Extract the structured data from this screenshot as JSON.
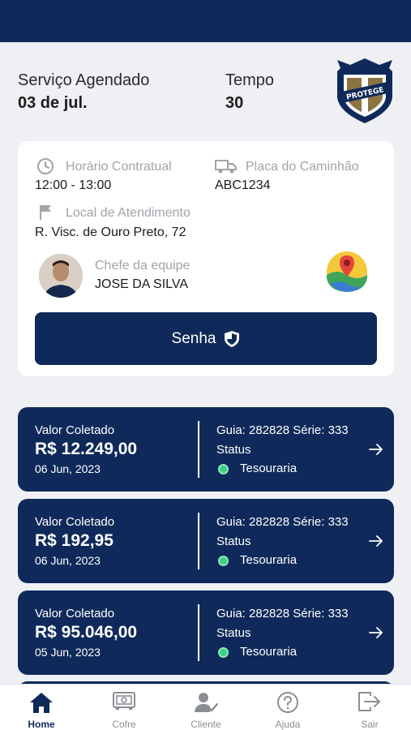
{
  "summary": {
    "service_label": "Serviço Agendado",
    "service_value": "03 de jul.",
    "time_label": "Tempo",
    "time_value": "30",
    "logo_text": "PROTEGE"
  },
  "details": {
    "contract_time_label": "Horário Contratual",
    "contract_time_value": "12:00 - 13:00",
    "truck_plate_label": "Placa do Caminhão",
    "truck_plate_value": "ABC1234",
    "location_label": "Local de Atendimento",
    "location_value": "R. Visc. de Ouro Preto, 72",
    "team_lead_label": "Chefe da equipe",
    "team_lead_value": "JOSE DA SILVA",
    "password_button": "Senha"
  },
  "transactions": [
    {
      "label": "Valor Coletado",
      "amount": "R$ 12.249,00",
      "date": "06 Jun, 2023",
      "guia": "Guia: 282828 Série: 333",
      "status_label": "Status",
      "status_value": "Tesouraria"
    },
    {
      "label": "Valor Coletado",
      "amount": "R$ 192,95",
      "date": "06 Jun, 2023",
      "guia": "Guia: 282828 Série: 333",
      "status_label": "Status",
      "status_value": "Tesouraria"
    },
    {
      "label": "Valor Coletado",
      "amount": "R$ 95.046,00",
      "date": "05 Jun, 2023",
      "guia": "Guia: 282828 Série: 333",
      "status_label": "Status",
      "status_value": "Tesouraria"
    }
  ],
  "nav": [
    {
      "label": "Home",
      "icon": "home-icon",
      "active": true
    },
    {
      "label": "Cofre",
      "icon": "safe-icon",
      "active": false
    },
    {
      "label": "Cliente",
      "icon": "client-icon",
      "active": false
    },
    {
      "label": "Ajuda",
      "icon": "help-icon",
      "active": false
    },
    {
      "label": "Sair",
      "icon": "logout-icon",
      "active": false
    }
  ],
  "colors": {
    "primary": "#0f2a5a",
    "status_ok": "#3ccf86",
    "background": "#eef0f3"
  }
}
